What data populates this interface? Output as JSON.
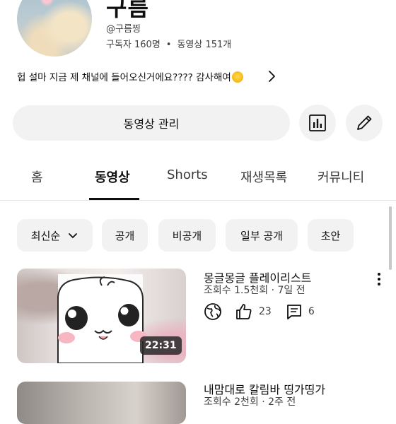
{
  "channel": {
    "name": "구름",
    "handle": "@구름찡",
    "subscribers": "구독자 160명",
    "separator": "•",
    "video_count": "동영상 151개",
    "description": "헙 설마 지금 제 채널에 들어오신거에요???? 감사해여"
  },
  "actions": {
    "manage_videos": "동영상 관리",
    "stats_icon": "bar-chart-icon",
    "edit_icon": "pencil-icon"
  },
  "tabs": [
    {
      "label": "홈"
    },
    {
      "label": "동영상",
      "active": true
    },
    {
      "label": "Shorts"
    },
    {
      "label": "재생목록"
    },
    {
      "label": "커뮤니티"
    }
  ],
  "filters": {
    "sort": "최신순",
    "chips": [
      "공개",
      "비공개",
      "일부 공개",
      "초안"
    ]
  },
  "videos": [
    {
      "title": "몽글몽글 플레이리스트",
      "meta": "조회수 1.5천회 · 7일 전",
      "duration": "22:31",
      "likes": "23",
      "comments": "6",
      "visibility_icon": "globe-icon"
    },
    {
      "title": "내맘대로 칼림바 띵가띵가",
      "meta": "조회수 2천회 · 2주 전"
    }
  ],
  "colors": {
    "background": "#ffffff",
    "chip_bg": "#f2f2f2",
    "text": "#0f0f0f",
    "secondary_text": "#3f3f3f"
  }
}
